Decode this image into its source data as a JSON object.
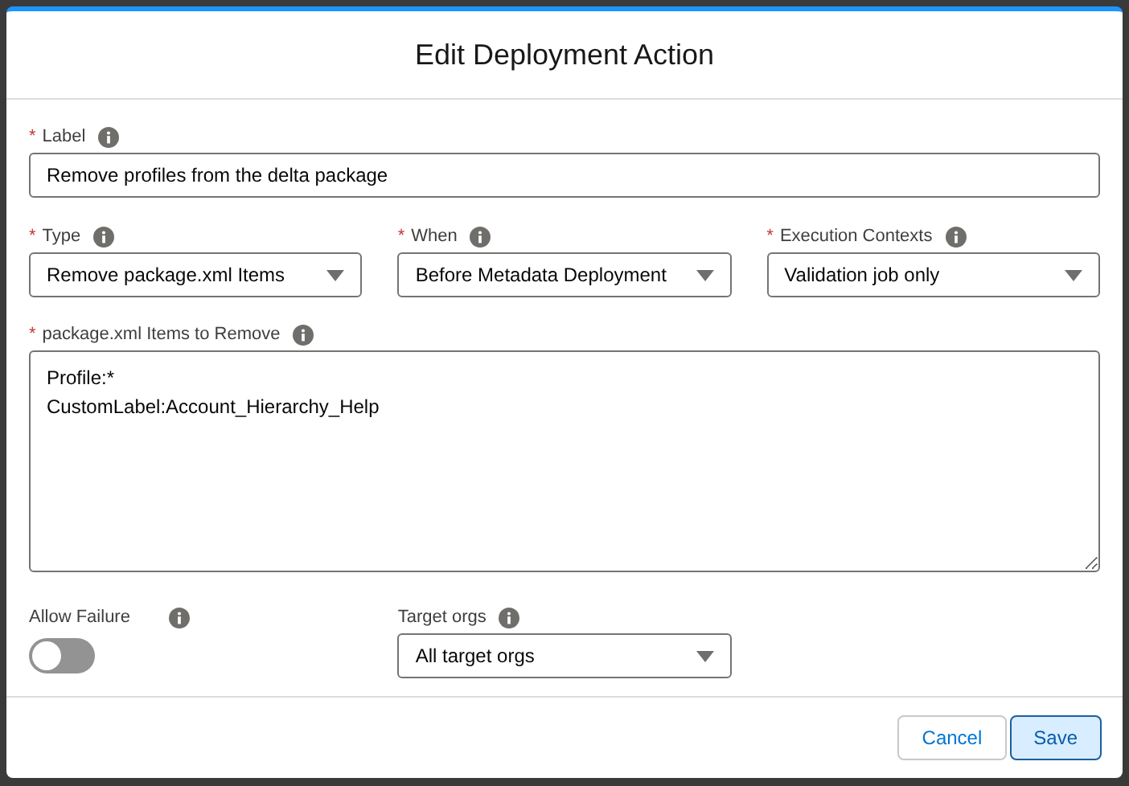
{
  "modal": {
    "title": "Edit Deployment Action"
  },
  "label_field": {
    "label": "Label",
    "required_mark": "*",
    "value": "Remove profiles from the delta package"
  },
  "selects": [
    {
      "label": "Type",
      "required_mark": "*",
      "value": "Remove package.xml Items"
    },
    {
      "label": "When",
      "required_mark": "*",
      "value": "Before Metadata Deployment"
    },
    {
      "label": "Execution Contexts",
      "required_mark": "*",
      "value": "Validation job only"
    }
  ],
  "items_field": {
    "label": "package.xml Items to Remove",
    "required_mark": "*",
    "lines": [
      "Profile:*",
      "CustomLabel:Account_Hierarchy_Help"
    ]
  },
  "allow_failure": {
    "label": "Allow Failure",
    "on": false
  },
  "target_orgs": {
    "label": "Target orgs",
    "value": "All target orgs"
  },
  "buttons": [
    {
      "label": "Cancel",
      "kind": "neutral"
    },
    {
      "label": "Save",
      "kind": "brand"
    }
  ]
}
